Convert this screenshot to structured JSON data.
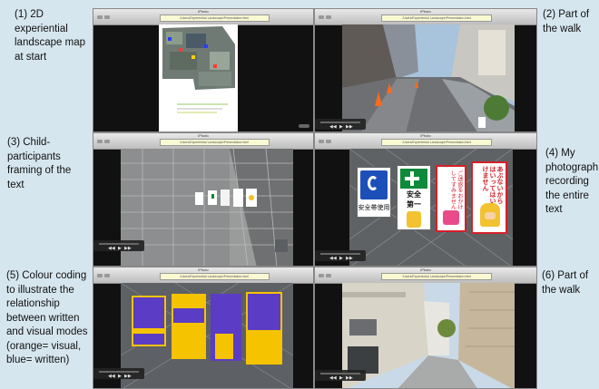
{
  "captions": [
    "(1) 2D experiential landscape map at start",
    "(2) Part of the walk",
    "(3) Child-participants framing of the text",
    "(4) My photograph recording the entire text",
    "(5) Colour coding to illustrate the relationship between written and visual modes (orange= visual, blue= written)",
    "(6) Part of the walk"
  ],
  "window": {
    "title": "iPhoto",
    "url": "/Users/Experiential Landscape/Presentation.html"
  },
  "signs": {
    "s1": "安全帯使用",
    "s2a": "安全",
    "s2b": "第一",
    "s3": "ご迷惑をおかけしてすみません",
    "s4": "あぶないからはいってはいけません"
  },
  "colors": {
    "accent": "#ffcc00",
    "written": "#5b3cc4",
    "background": "#d6e6ee"
  }
}
